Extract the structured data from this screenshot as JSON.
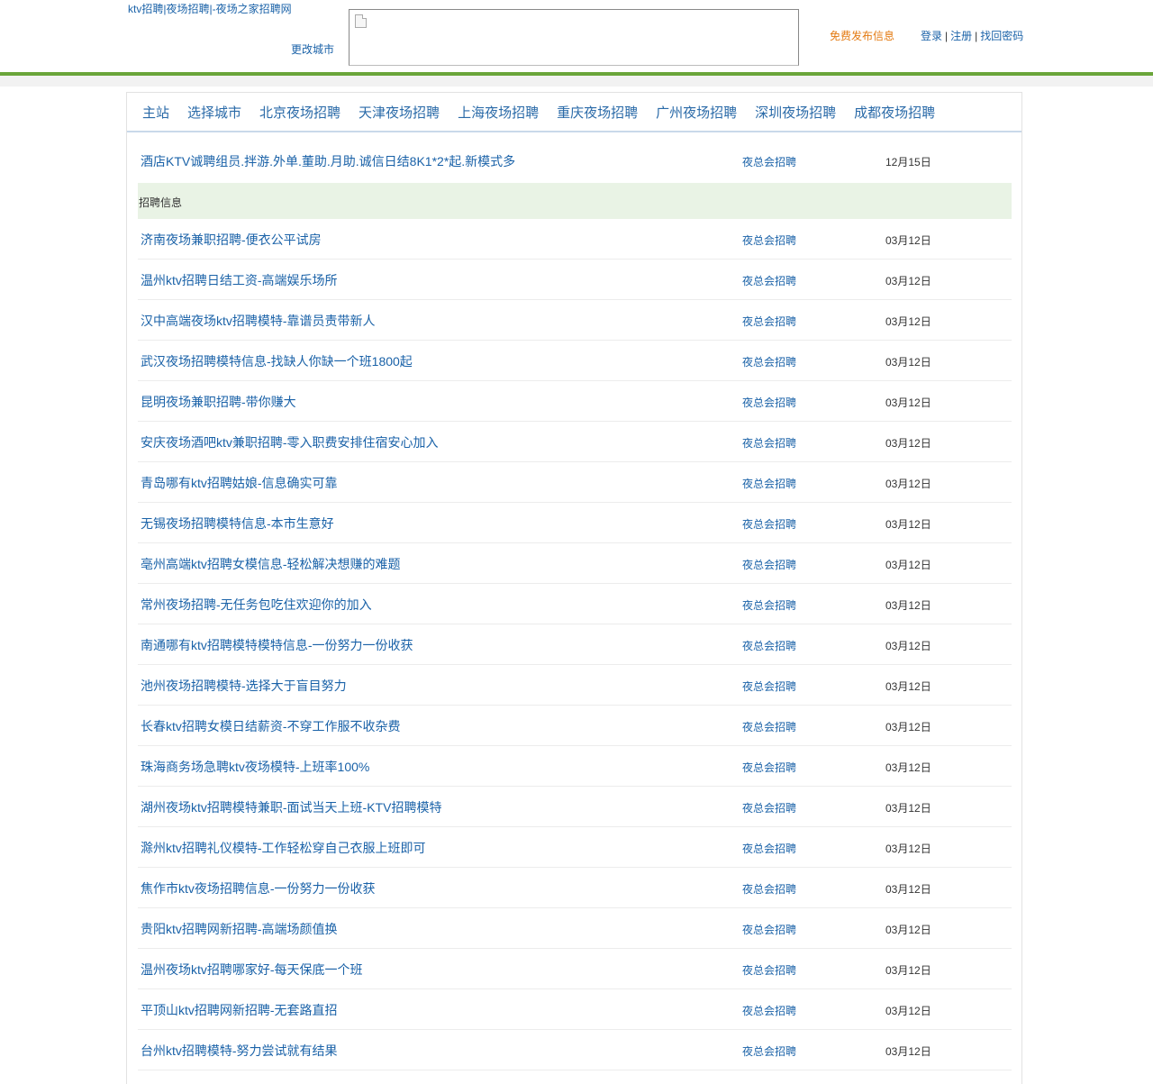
{
  "header": {
    "site_title": "ktv招聘|夜场招聘|-夜场之家招聘网",
    "change_city": "更改城市",
    "publish_link": "免费发布信息",
    "login": "登录",
    "register": "注册",
    "forgot_password": "找回密码",
    "separator": "|"
  },
  "colors": {
    "link_blue": "#1a62a8",
    "accent_green": "#6aa53a",
    "publish_orange": "#e37a12",
    "section_bg": "#e9f3e5"
  },
  "nav": {
    "items": [
      {
        "label": "主站"
      },
      {
        "label": "选择城市"
      },
      {
        "label": "北京夜场招聘"
      },
      {
        "label": "天津夜场招聘"
      },
      {
        "label": "上海夜场招聘"
      },
      {
        "label": "重庆夜场招聘"
      },
      {
        "label": "广州夜场招聘"
      },
      {
        "label": "深圳夜场招聘"
      },
      {
        "label": "成都夜场招聘"
      }
    ]
  },
  "top_post": {
    "title": "酒店KTV诚聘组员.拌游.外单.董助.月助.诚信日结8K1*2*起.新模式多",
    "category": "夜总会招聘",
    "date": "12月15日"
  },
  "section_title": "招聘信息",
  "posts": [
    {
      "title": "济南夜场兼职招聘-便衣公平试房",
      "category": "夜总会招聘",
      "date": "03月12日"
    },
    {
      "title": "温州ktv招聘日结工资-高端娱乐场所",
      "category": "夜总会招聘",
      "date": "03月12日"
    },
    {
      "title": "汉中高端夜场ktv招聘模特-靠谱员责带新人",
      "category": "夜总会招聘",
      "date": "03月12日"
    },
    {
      "title": "武汉夜场招聘模特信息-找缺人你缺一个班1800起",
      "category": "夜总会招聘",
      "date": "03月12日"
    },
    {
      "title": "昆明夜场兼职招聘-带你赚大",
      "category": "夜总会招聘",
      "date": "03月12日"
    },
    {
      "title": "安庆夜场酒吧ktv兼职招聘-零入职费安排住宿安心加入",
      "category": "夜总会招聘",
      "date": "03月12日"
    },
    {
      "title": "青岛哪有ktv招聘姑娘-信息确实可靠",
      "category": "夜总会招聘",
      "date": "03月12日"
    },
    {
      "title": "无锡夜场招聘模特信息-本市生意好",
      "category": "夜总会招聘",
      "date": "03月12日"
    },
    {
      "title": "亳州高端ktv招聘女模信息-轻松解决想赚的难题",
      "category": "夜总会招聘",
      "date": "03月12日"
    },
    {
      "title": "常州夜场招聘-无任务包吃住欢迎你的加入",
      "category": "夜总会招聘",
      "date": "03月12日"
    },
    {
      "title": "南通哪有ktv招聘模特模特信息-一份努力一份收获",
      "category": "夜总会招聘",
      "date": "03月12日"
    },
    {
      "title": "池州夜场招聘模特-选择大于盲目努力",
      "category": "夜总会招聘",
      "date": "03月12日"
    },
    {
      "title": "长春ktv招聘女模日结薪资-不穿工作服不收杂费",
      "category": "夜总会招聘",
      "date": "03月12日"
    },
    {
      "title": "珠海商务场急聘ktv夜场模特-上班率100%",
      "category": "夜总会招聘",
      "date": "03月12日"
    },
    {
      "title": "湖州夜场ktv招聘模特兼职-面试当天上班-KTV招聘模特",
      "category": "夜总会招聘",
      "date": "03月12日"
    },
    {
      "title": "滁州ktv招聘礼仪模特-工作轻松穿自己衣服上班即可",
      "category": "夜总会招聘",
      "date": "03月12日"
    },
    {
      "title": "焦作市ktv夜场招聘信息-一份努力一份收获",
      "category": "夜总会招聘",
      "date": "03月12日"
    },
    {
      "title": "贵阳ktv招聘网新招聘-高端场颜值换",
      "category": "夜总会招聘",
      "date": "03月12日"
    },
    {
      "title": "温州夜场ktv招聘哪家好-每天保底一个班",
      "category": "夜总会招聘",
      "date": "03月12日"
    },
    {
      "title": "平顶山ktv招聘网新招聘-无套路直招",
      "category": "夜总会招聘",
      "date": "03月12日"
    },
    {
      "title": "台州ktv招聘模特-努力尝试就有结果",
      "category": "夜总会招聘",
      "date": "03月12日"
    }
  ]
}
